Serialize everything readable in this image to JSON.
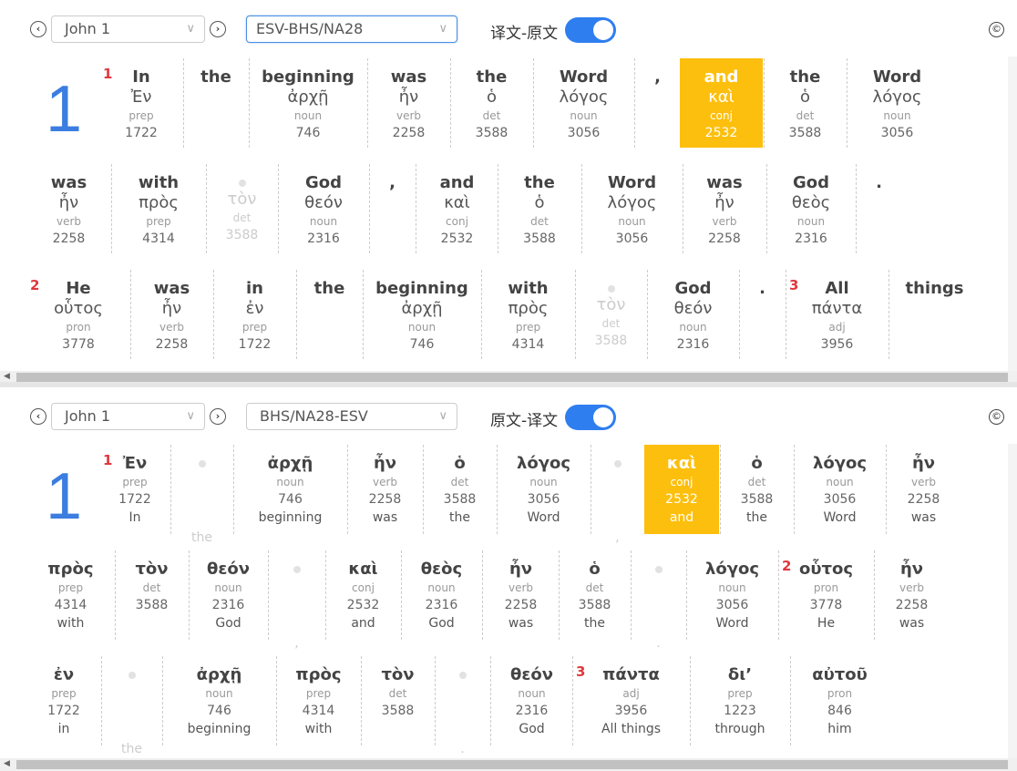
{
  "top": {
    "book_select": "John 1",
    "version_select": "ESV-BHS/NA28",
    "toggle_label": "译文-原文",
    "copyright": "©",
    "chapter": "1",
    "rows": [
      [
        {
          "v": "1",
          "w": "In",
          "g": "Ἐν",
          "pos": "prep",
          "num": "1722"
        },
        {
          "w": "the",
          "g": "",
          "pos": "",
          "num": ""
        },
        {
          "w": "beginning",
          "g": "ἀρχῇ",
          "pos": "noun",
          "num": "746"
        },
        {
          "w": "was",
          "g": "ἦν",
          "pos": "verb",
          "num": "2258"
        },
        {
          "w": "the",
          "g": "ὁ",
          "pos": "det",
          "num": "3588"
        },
        {
          "w": "Word",
          "g": "λόγος",
          "pos": "noun",
          "num": "3056"
        },
        {
          "w": ",",
          "g": "",
          "pos": "",
          "num": ""
        },
        {
          "w": "and",
          "g": "καὶ",
          "pos": "conj",
          "num": "2532",
          "hl": true
        },
        {
          "w": "the",
          "g": "ὁ",
          "pos": "det",
          "num": "3588"
        },
        {
          "w": "Word",
          "g": "λόγος",
          "pos": "noun",
          "num": "3056"
        }
      ],
      [
        {
          "w": "was",
          "g": "ἦν",
          "pos": "verb",
          "num": "2258"
        },
        {
          "w": "with",
          "g": "πρὸς",
          "pos": "prep",
          "num": "4314"
        },
        {
          "faded": true,
          "g": "τὸν",
          "pos": "det",
          "num": "3588"
        },
        {
          "w": "God",
          "g": "θεόν",
          "pos": "noun",
          "num": "2316"
        },
        {
          "w": ",",
          "g": "",
          "pos": "",
          "num": ""
        },
        {
          "w": "and",
          "g": "καὶ",
          "pos": "conj",
          "num": "2532"
        },
        {
          "w": "the",
          "g": "ὁ",
          "pos": "det",
          "num": "3588"
        },
        {
          "w": "Word",
          "g": "λόγος",
          "pos": "noun",
          "num": "3056"
        },
        {
          "w": "was",
          "g": "ἦν",
          "pos": "verb",
          "num": "2258"
        },
        {
          "w": "God",
          "g": "θεὸς",
          "pos": "noun",
          "num": "2316"
        },
        {
          "w": ".",
          "g": "",
          "pos": "",
          "num": ""
        }
      ],
      [
        {
          "v": "2",
          "w": "He",
          "g": "οὗτος",
          "pos": "pron",
          "num": "3778"
        },
        {
          "w": "was",
          "g": "ἦν",
          "pos": "verb",
          "num": "2258"
        },
        {
          "w": "in",
          "g": "ἐν",
          "pos": "prep",
          "num": "1722"
        },
        {
          "w": "the",
          "g": "",
          "pos": "",
          "num": ""
        },
        {
          "w": "beginning",
          "g": "ἀρχῇ",
          "pos": "noun",
          "num": "746"
        },
        {
          "w": "with",
          "g": "πρὸς",
          "pos": "prep",
          "num": "4314"
        },
        {
          "faded": true,
          "g": "τὸν",
          "pos": "det",
          "num": "3588"
        },
        {
          "w": "God",
          "g": "θεόν",
          "pos": "noun",
          "num": "2316"
        },
        {
          "w": ".",
          "g": "",
          "pos": "",
          "num": ""
        },
        {
          "v": "3",
          "w": "All",
          "g": "πάντα",
          "pos": "adj",
          "num": "3956"
        },
        {
          "w": "things",
          "g": "",
          "pos": "",
          "num": ""
        }
      ]
    ]
  },
  "bottom": {
    "book_select": "John 1",
    "version_select": "BHS/NA28-ESV",
    "toggle_label": "原文-译文",
    "copyright": "©",
    "chapter": "1",
    "rows": [
      [
        {
          "v": "1",
          "w": "Ἐν",
          "pos": "prep",
          "num": "1722",
          "en": "In"
        },
        {
          "faded": true,
          "w": "",
          "pos": "",
          "num": "",
          "en": "the"
        },
        {
          "w": "ἀρχῇ",
          "pos": "noun",
          "num": "746",
          "en": "beginning"
        },
        {
          "w": "ἦν",
          "pos": "verb",
          "num": "2258",
          "en": "was"
        },
        {
          "w": "ὁ",
          "pos": "det",
          "num": "3588",
          "en": "the"
        },
        {
          "w": "λόγος",
          "pos": "noun",
          "num": "3056",
          "en": "Word"
        },
        {
          "faded": true,
          "w": "",
          "pos": "",
          "num": "",
          "en": ","
        },
        {
          "w": "καὶ",
          "pos": "conj",
          "num": "2532",
          "en": "and",
          "hl": true
        },
        {
          "w": "ὁ",
          "pos": "det",
          "num": "3588",
          "en": "the"
        },
        {
          "w": "λόγος",
          "pos": "noun",
          "num": "3056",
          "en": "Word"
        },
        {
          "w": "ἦν",
          "pos": "verb",
          "num": "2258",
          "en": "was"
        }
      ],
      [
        {
          "w": "πρὸς",
          "pos": "prep",
          "num": "4314",
          "en": "with"
        },
        {
          "w": "τὸν",
          "pos": "det",
          "num": "3588",
          "en": ""
        },
        {
          "w": "θεόν",
          "pos": "noun",
          "num": "2316",
          "en": "God"
        },
        {
          "faded": true,
          "w": "",
          "pos": "",
          "num": "",
          "en": ","
        },
        {
          "w": "καὶ",
          "pos": "conj",
          "num": "2532",
          "en": "and"
        },
        {
          "w": "θεὸς",
          "pos": "noun",
          "num": "2316",
          "en": "God"
        },
        {
          "w": "ἦν",
          "pos": "verb",
          "num": "2258",
          "en": "was"
        },
        {
          "w": "ὁ",
          "pos": "det",
          "num": "3588",
          "en": "the"
        },
        {
          "faded": true,
          "w": "",
          "pos": "",
          "num": "",
          "en": "."
        },
        {
          "w": "λόγος",
          "pos": "noun",
          "num": "3056",
          "en": "Word"
        },
        {
          "v": "2",
          "w": "οὗτος",
          "pos": "pron",
          "num": "3778",
          "en": "He"
        },
        {
          "w": "ἦν",
          "pos": "verb",
          "num": "2258",
          "en": "was"
        }
      ],
      [
        {
          "w": "ἐν",
          "pos": "prep",
          "num": "1722",
          "en": "in"
        },
        {
          "faded": true,
          "w": "",
          "pos": "",
          "num": "",
          "en": "the"
        },
        {
          "w": "ἀρχῇ",
          "pos": "noun",
          "num": "746",
          "en": "beginning"
        },
        {
          "w": "πρὸς",
          "pos": "prep",
          "num": "4314",
          "en": "with"
        },
        {
          "w": "τὸν",
          "pos": "det",
          "num": "3588",
          "en": ""
        },
        {
          "faded": true,
          "w": "",
          "pos": "",
          "num": "",
          "en": "."
        },
        {
          "w": "θεόν",
          "pos": "noun",
          "num": "2316",
          "en": "God"
        },
        {
          "v": "3",
          "w": "πάντα",
          "pos": "adj",
          "num": "3956",
          "en": "All   things"
        },
        {
          "w": "δι’",
          "pos": "prep",
          "num": "1223",
          "en": "through"
        },
        {
          "w": "αὐτοῦ",
          "pos": "pron",
          "num": "846",
          "en": "him"
        }
      ]
    ]
  }
}
